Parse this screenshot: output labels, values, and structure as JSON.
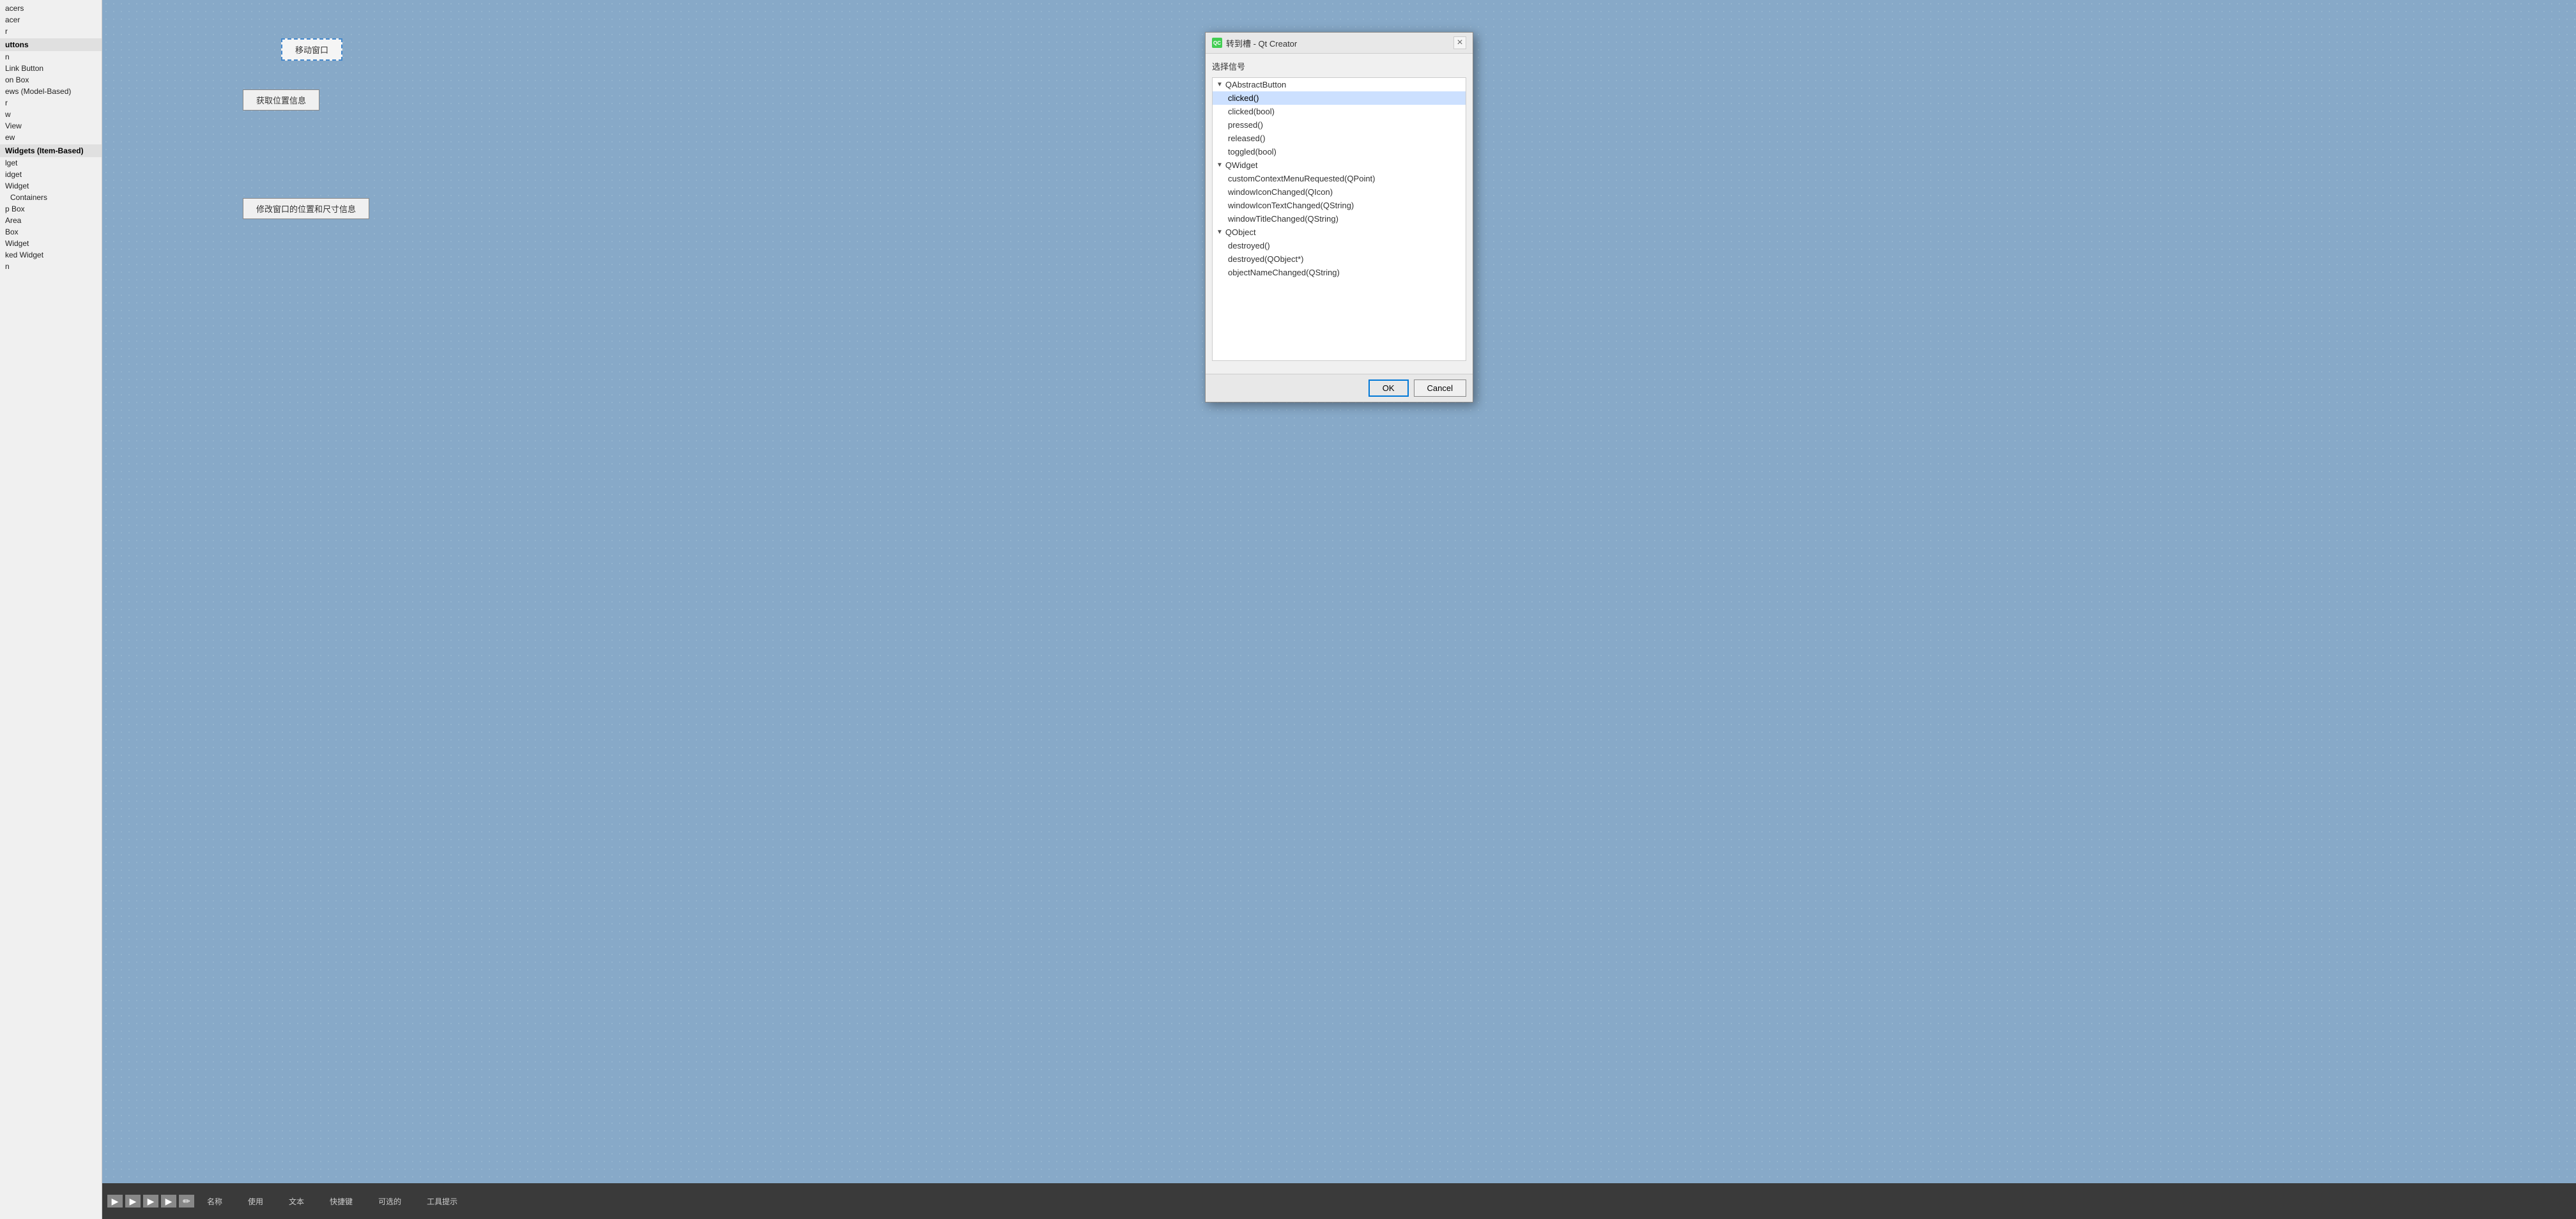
{
  "sidebar": {
    "items": [
      {
        "label": "acers",
        "type": "item"
      },
      {
        "label": "acer",
        "type": "item"
      },
      {
        "label": "r",
        "type": "item"
      },
      {
        "label": "uttons",
        "type": "header"
      },
      {
        "label": "n",
        "type": "item"
      },
      {
        "label": "Link Button",
        "type": "item"
      },
      {
        "label": "on Box",
        "type": "item"
      },
      {
        "label": "ews (Model-Based)",
        "type": "item"
      },
      {
        "label": "r",
        "type": "item"
      },
      {
        "label": "w",
        "type": "item"
      },
      {
        "label": "View",
        "type": "item"
      },
      {
        "label": "ew",
        "type": "item"
      },
      {
        "label": "Widgets (Item-Based)",
        "type": "header"
      },
      {
        "label": "lget",
        "type": "item"
      },
      {
        "label": "idget",
        "type": "item"
      },
      {
        "label": "Widget",
        "type": "item"
      },
      {
        "label": "Containers",
        "type": "sub"
      },
      {
        "label": "p Box",
        "type": "item"
      },
      {
        "label": "Area",
        "type": "item"
      },
      {
        "label": "Box",
        "type": "item"
      },
      {
        "label": "Widget",
        "type": "item"
      },
      {
        "label": "ked Widget",
        "type": "item"
      },
      {
        "label": "n",
        "type": "item"
      }
    ]
  },
  "canvas": {
    "move_window_label": "移动窗口",
    "get_position_label": "获取位置信息",
    "modify_window_label": "修改窗口的位置和尺寸信息"
  },
  "toolbar": {
    "columns": [
      "名称",
      "使用",
      "文本",
      "快捷键",
      "可选的",
      "工具提示"
    ]
  },
  "modal": {
    "title": "转到槽 - Qt Creator",
    "qt_logo": "QC",
    "close_btn": "×",
    "subtitle": "选择信号",
    "ok_label": "OK",
    "cancel_label": "Cancel",
    "tree": {
      "groups": [
        {
          "name": "QAbstractButton",
          "items": [
            {
              "label": "clicked()",
              "selected": true
            },
            {
              "label": "clicked(bool)"
            },
            {
              "label": "pressed()"
            },
            {
              "label": "released()"
            },
            {
              "label": "toggled(bool)"
            }
          ]
        },
        {
          "name": "QWidget",
          "items": [
            {
              "label": "customContextMenuRequested(QPoint)"
            },
            {
              "label": "windowIconChanged(QIcon)"
            },
            {
              "label": "windowIconTextChanged(QString)"
            },
            {
              "label": "windowTitleChanged(QString)"
            }
          ]
        },
        {
          "name": "QObject",
          "items": [
            {
              "label": "destroyed()"
            },
            {
              "label": "destroyed(QObject*)"
            },
            {
              "label": "objectNameChanged(QString)"
            }
          ]
        }
      ]
    }
  }
}
